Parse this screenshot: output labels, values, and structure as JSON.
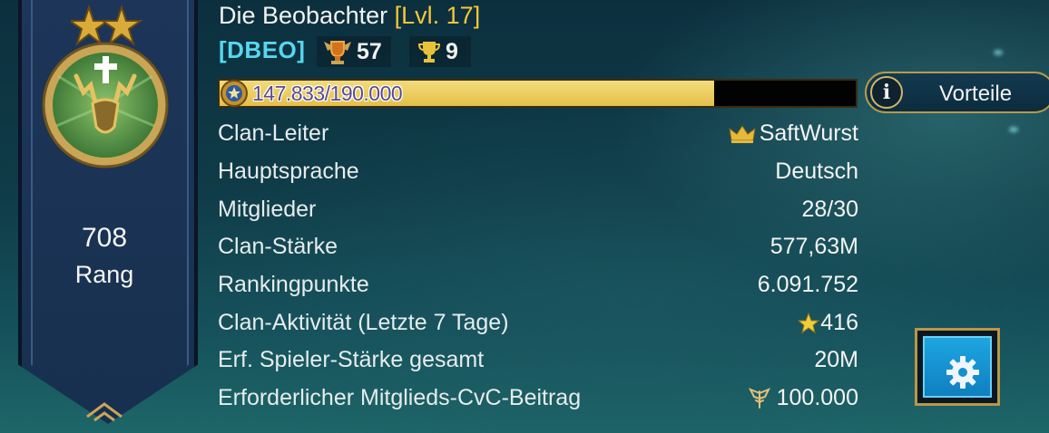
{
  "clan": {
    "name": "Die Beobachter",
    "level": "[Lvl. 17]",
    "tag": "[DBEO]",
    "badge_1_value": "57",
    "badge_2_value": "9"
  },
  "progress": {
    "text": "147.833/190.000",
    "current": 147833,
    "max": 190000
  },
  "rank": {
    "value": "708",
    "label": "Rang"
  },
  "buttons": {
    "benefits_label": "Vorteile",
    "info_icon_glyph": "i"
  },
  "rows": [
    {
      "label": "Clan-Leiter",
      "value": "SaftWurst",
      "icon": "crown-icon"
    },
    {
      "label": "Hauptsprache",
      "value": "Deutsch"
    },
    {
      "label": "Mitglieder",
      "value": "28/30"
    },
    {
      "label": "Clan-Stärke",
      "value": "577,63M"
    },
    {
      "label": "Rankingpunkte",
      "value": "6.091.752"
    },
    {
      "label": "Clan-Aktivität (Letzte 7 Tage)",
      "value": "416",
      "icon": "star-icon"
    },
    {
      "label": "Erf. Spieler-Stärke gesamt",
      "value": "20M"
    },
    {
      "label": "Erforderlicher Mitglieds-CvC-Beitrag",
      "value": "100.000",
      "icon": "winged-emblem-icon"
    }
  ],
  "colors": {
    "accent_gold": "#f3c73a",
    "tag_cyan": "#56d7ef",
    "progress_fill": "#e3c04a",
    "settings_blue": "#1ea6e0"
  }
}
